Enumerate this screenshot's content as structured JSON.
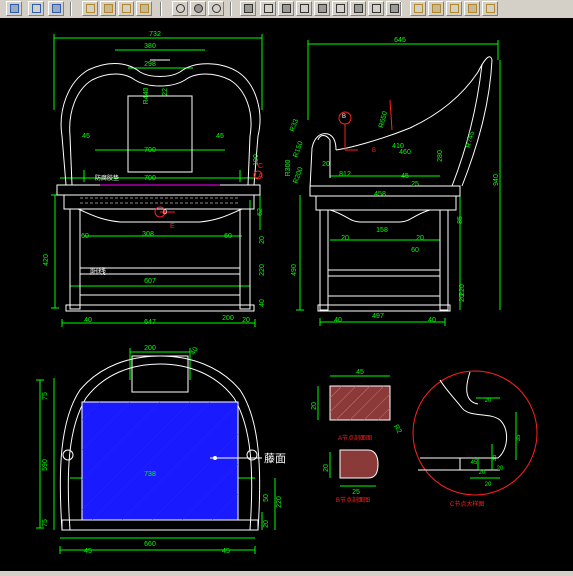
{
  "toolbar": {
    "buttons": [
      {
        "icon": "pan-icon",
        "color": "#2a5db0"
      },
      {
        "icon": "navigate-icon",
        "color": "#2a5db0"
      },
      {
        "icon": "cube-icon",
        "color": "#2a5db0"
      },
      {
        "icon": "box-icon",
        "color": "#b08a2a"
      },
      {
        "icon": "box-icon",
        "color": "#b08a2a"
      },
      {
        "icon": "box-icon",
        "color": "#b08a2a"
      },
      {
        "icon": "box-icon",
        "color": "#b08a2a"
      },
      {
        "icon": "orbit-icon",
        "color": "#333333"
      },
      {
        "icon": "orbit-icon",
        "color": "#333333"
      },
      {
        "icon": "orbit-icon",
        "color": "#333333"
      },
      {
        "icon": "solid-box-icon",
        "color": "#333333"
      },
      {
        "icon": "solid-box-icon",
        "color": "#333333"
      },
      {
        "icon": "solid-box-icon",
        "color": "#333333"
      },
      {
        "icon": "solid-box-icon",
        "color": "#333333"
      },
      {
        "icon": "solid-box-icon",
        "color": "#333333"
      },
      {
        "icon": "solid-box-icon",
        "color": "#333333"
      },
      {
        "icon": "solid-box-icon",
        "color": "#333333"
      },
      {
        "icon": "solid-box-icon",
        "color": "#333333"
      },
      {
        "icon": "solid-box-icon",
        "color": "#333333"
      },
      {
        "icon": "edit-box-icon",
        "color": "#b08a2a"
      },
      {
        "icon": "edit-box-icon",
        "color": "#b08a2a"
      },
      {
        "icon": "edit-box-icon",
        "color": "#b08a2a"
      },
      {
        "icon": "edit-box-icon",
        "color": "#b08a2a"
      },
      {
        "icon": "edit-box-icon",
        "color": "#b08a2a"
      }
    ]
  },
  "colors": {
    "background": "#000000",
    "dimension": "#00ff00",
    "outline": "#ffffff",
    "marker": "#ff2020",
    "seat": "#1a1aff",
    "hatch": "#c05050",
    "leader": "#ff00ff"
  },
  "front_view": {
    "dims": [
      "732",
      "380",
      "298",
      "R440",
      "22",
      "45",
      "45",
      "700",
      "700",
      "100",
      "62",
      "60",
      "308",
      "60",
      "420",
      "220",
      "40",
      "20",
      "607",
      "40",
      "647",
      "200",
      "20"
    ],
    "labels": [
      "A",
      "C",
      "D",
      "E",
      "阳线",
      "防腐胶垫"
    ]
  },
  "side_view": {
    "dims": [
      "645",
      "R33",
      "R650",
      "R745",
      "R150",
      "R200",
      "R300",
      "20",
      "812",
      "45",
      "410",
      "460",
      "280",
      "25",
      "458",
      "85",
      "20",
      "158",
      "20",
      "60",
      "490",
      "220",
      "20",
      "40",
      "497",
      "40",
      "940"
    ],
    "labels": [
      "B",
      "B"
    ]
  },
  "plan_view": {
    "dims": [
      "200",
      "40",
      "75",
      "590",
      "75",
      "738",
      "45",
      "660",
      "45",
      "220",
      "20",
      "50"
    ],
    "labels": [
      "藤面"
    ]
  },
  "details": {
    "a_dims": [
      "45",
      "20",
      "R2"
    ],
    "a_caption": "A节点剖面图",
    "b_dims": [
      "20",
      "25"
    ],
    "b_caption": "B节点剖面图",
    "c_dims": [
      "20",
      "35",
      "45",
      "20",
      "35",
      "20",
      "20"
    ],
    "c_caption": "C节点大样图"
  }
}
